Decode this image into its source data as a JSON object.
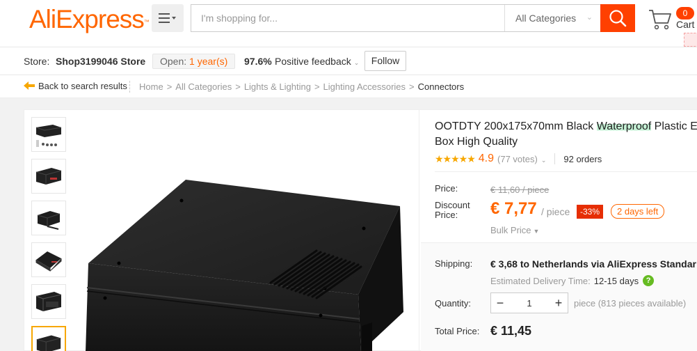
{
  "header": {
    "logo_ali": "Ali",
    "logo_express": "Express",
    "logo_tm": "™",
    "search_placeholder": "I'm shopping for...",
    "category_select": "All Categories",
    "cart_count": "0",
    "cart_label": "Cart"
  },
  "store": {
    "label": "Store:",
    "name": "Shop3199046 Store",
    "open_prefix": "Open:",
    "open_years": "1 year(s)",
    "feedback_pct": "97.6%",
    "feedback_label": "Positive feedback",
    "follow_label": "Follow"
  },
  "breadcrumb": {
    "back_label": "Back to search results",
    "items": [
      "Home",
      "All Categories",
      "Lights & Lighting",
      "Lighting Accessories",
      "Connectors"
    ],
    "separator": ">"
  },
  "product": {
    "title_part1": "OOTDTY 200x175x70mm Black ",
    "title_highlight": "Waterproof",
    "title_part2": " Plastic E",
    "title_line2": "Box High Quality",
    "stars": "★★★★★",
    "rating": "4.9",
    "votes": "(77 votes)",
    "orders": "92 orders"
  },
  "pricing": {
    "price_label": "Price:",
    "old_price": "€ 11,60 / piece",
    "discount_label_1": "Discount",
    "discount_label_2": "Price:",
    "discount_price": "€ 7,77",
    "per_piece": "/ piece",
    "discount_pct": "-33%",
    "days_left": "2 days left",
    "bulk_price": "Bulk Price"
  },
  "shipping": {
    "label": "Shipping:",
    "value": "€ 3,68 to Netherlands via AliExpress Standar",
    "est_label": "Estimated Delivery Time:",
    "est_days": "12-15 days",
    "help": "?"
  },
  "quantity": {
    "label": "Quantity:",
    "value": "1",
    "minus": "−",
    "plus": "+",
    "available": "piece (813 pieces available)"
  },
  "total": {
    "label": "Total Price:",
    "value": "€ 11,45"
  },
  "colors": {
    "accent": "#ff6600",
    "search_button": "#ff4000",
    "discount_badge": "#e62e04",
    "star": "#f7a700",
    "help_badge": "#66bb22"
  }
}
